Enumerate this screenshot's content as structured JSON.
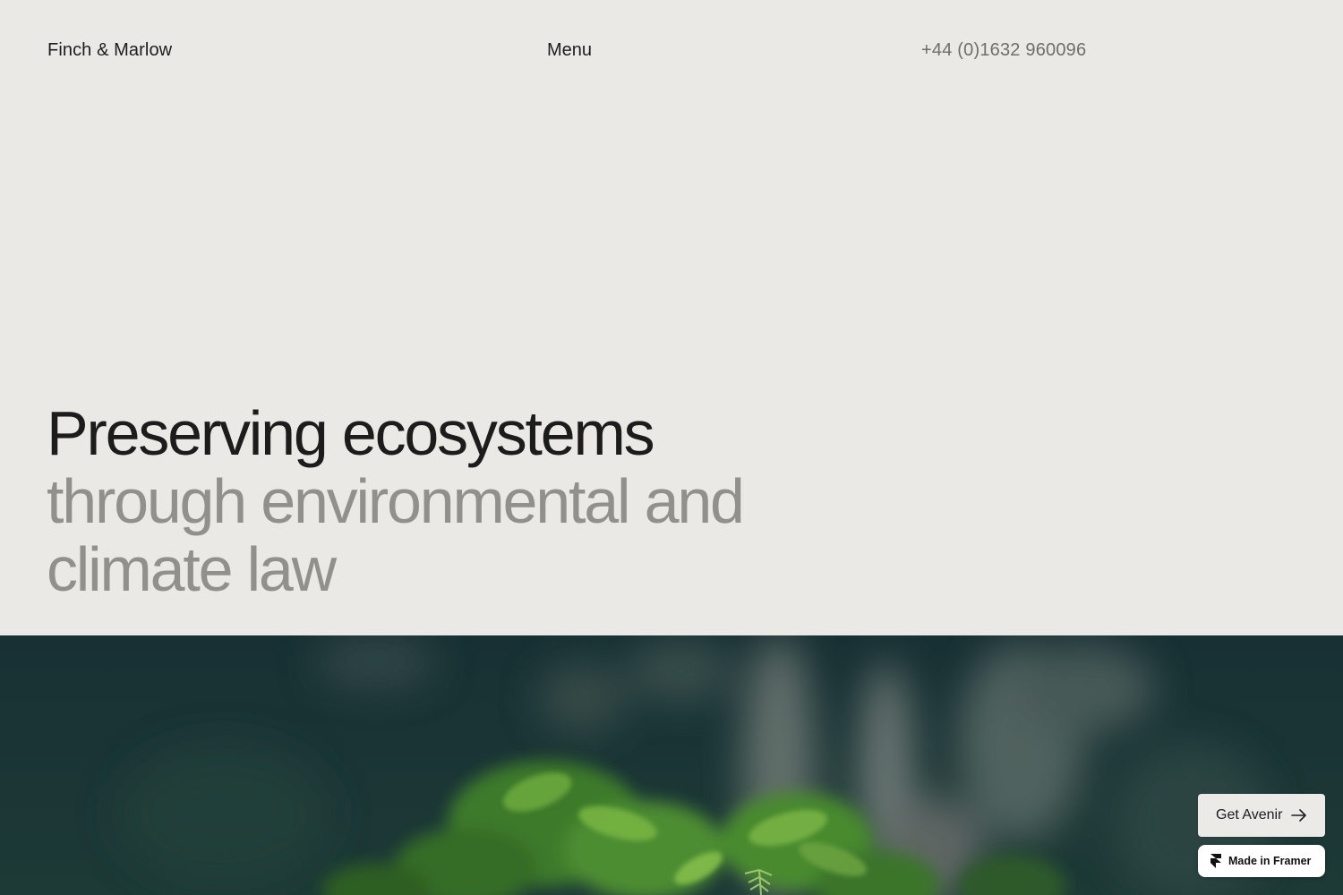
{
  "header": {
    "brand": "Finch & Marlow",
    "menu_label": "Menu",
    "phone": "+44 (0)1632 960096"
  },
  "hero": {
    "heading_primary": "Preserving ecosystems",
    "heading_secondary": "through environmental and climate law",
    "image_description_icon": "forest-fern-photo"
  },
  "widgets": {
    "get_template_label": "Get Avenir",
    "get_template_icon": "arrow-right-icon",
    "made_in_label": "Made in Framer",
    "made_in_icon": "framer-logo-icon"
  },
  "colors": {
    "page_background": "#eae9e5",
    "heading_primary": "#1c1c1c",
    "heading_secondary": "#91908c",
    "phone_text": "#6e6e6b",
    "photo_background": "#1b3236"
  }
}
